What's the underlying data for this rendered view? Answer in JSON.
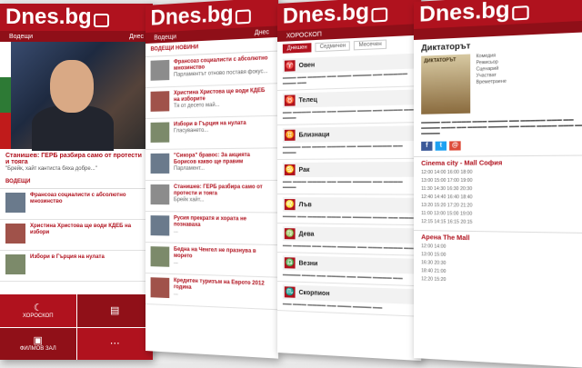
{
  "brand": {
    "logo": "Dnes.bg",
    "accent": "#b0121e",
    "accent_dark": "#8f0f18"
  },
  "panel1": {
    "nav_left": "Водещи",
    "nav_right": "Днес",
    "headline": "Станишев: ГЕРБ разбира само от протести и тояга",
    "quote": "\"Брейк, хайт кантиста бяха добре...\"",
    "section": "ВОДЕЩИ",
    "items": [
      {
        "title": "Франсоаз социалисти с абсолютно мнозинство"
      },
      {
        "title": "Христина Христова ще води КДЕБ на избори"
      },
      {
        "title": "Избори в Гърция на нулата"
      }
    ],
    "tiles": [
      {
        "label": "ХОРОСКОП",
        "icon": "horoscope-icon"
      },
      {
        "label": "",
        "icon": "news-icon"
      },
      {
        "label": "ФИЛМОВ ЗАЛ",
        "icon": "film-icon"
      },
      {
        "label": "",
        "icon": "more-icon"
      }
    ]
  },
  "panel2": {
    "nav_left": "Водещи",
    "nav_right": "Днес",
    "section": "ВОДЕЩИ НОВИНИ",
    "items": [
      {
        "title": "Франсоаз социалисти с абсолютно мнозинство",
        "sub": "Парламентът отново поставя фокус..."
      },
      {
        "title": "Христина Христова ще води КДЕБ на изборите",
        "sub": "Тя от десето май..."
      },
      {
        "title": "Избори в Гърция на нулата",
        "sub": "Гласуването..."
      },
      {
        "title": "\"Сикора\" бравос: За акцията Борисов какво ще правим",
        "sub": "Парламент..."
      },
      {
        "title": "Станишев: ГЕРБ разбира само от протести и тояга",
        "sub": "Брейк хайт..."
      },
      {
        "title": "Русия прекратя и хората не познаваха",
        "sub": "..."
      },
      {
        "title": "Бедна на Ченгел не празнува в морето",
        "sub": "..."
      },
      {
        "title": "Кредитен туризъм на Еврото 2012 година",
        "sub": "..."
      }
    ]
  },
  "panel3": {
    "nav_left": "ХОРОСКОП",
    "tabs": [
      "Днешен",
      "Седмичен",
      "Месечен"
    ],
    "signs": [
      {
        "name": "Овен",
        "icon": "aries-icon",
        "glyph": "♈"
      },
      {
        "name": "Телец",
        "icon": "taurus-icon",
        "glyph": "♉"
      },
      {
        "name": "Близнаци",
        "icon": "gemini-icon",
        "glyph": "♊"
      },
      {
        "name": "Рак",
        "icon": "cancer-icon",
        "glyph": "♋"
      },
      {
        "name": "Лъв",
        "icon": "leo-icon",
        "glyph": "♌"
      },
      {
        "name": "Дева",
        "icon": "virgo-icon",
        "glyph": "♍"
      },
      {
        "name": "Везни",
        "icon": "libra-icon",
        "glyph": "♎"
      },
      {
        "name": "Скорпион",
        "icon": "scorpio-icon",
        "glyph": "♏"
      }
    ]
  },
  "panel4": {
    "title": "Диктаторът",
    "poster_text": "ДИКТАТОРЪТ",
    "meta": [
      "Комедия",
      "Режисьор",
      "Сценарий",
      "Участват",
      "Времетраене"
    ],
    "cinema1": "Cinema city - Mall София",
    "cinema2": "Арена The Mall",
    "times": [
      "12:00 14:00 16:00 18:00",
      "13:00 15:00 17:00 19:00",
      "11:30 14:30 16:30 20:30",
      "12:40 14:40 16:40 18:40",
      "13:20 15:20 17:20 21:20",
      "11:00 13:00 15:00 19:00",
      "12:15 14:15 16:15 20:15"
    ],
    "times2": [
      "12:00 14:00",
      "13:00 15:00",
      "16:30 20:30",
      "18:40 21:00",
      "12:20 15:20"
    ]
  }
}
